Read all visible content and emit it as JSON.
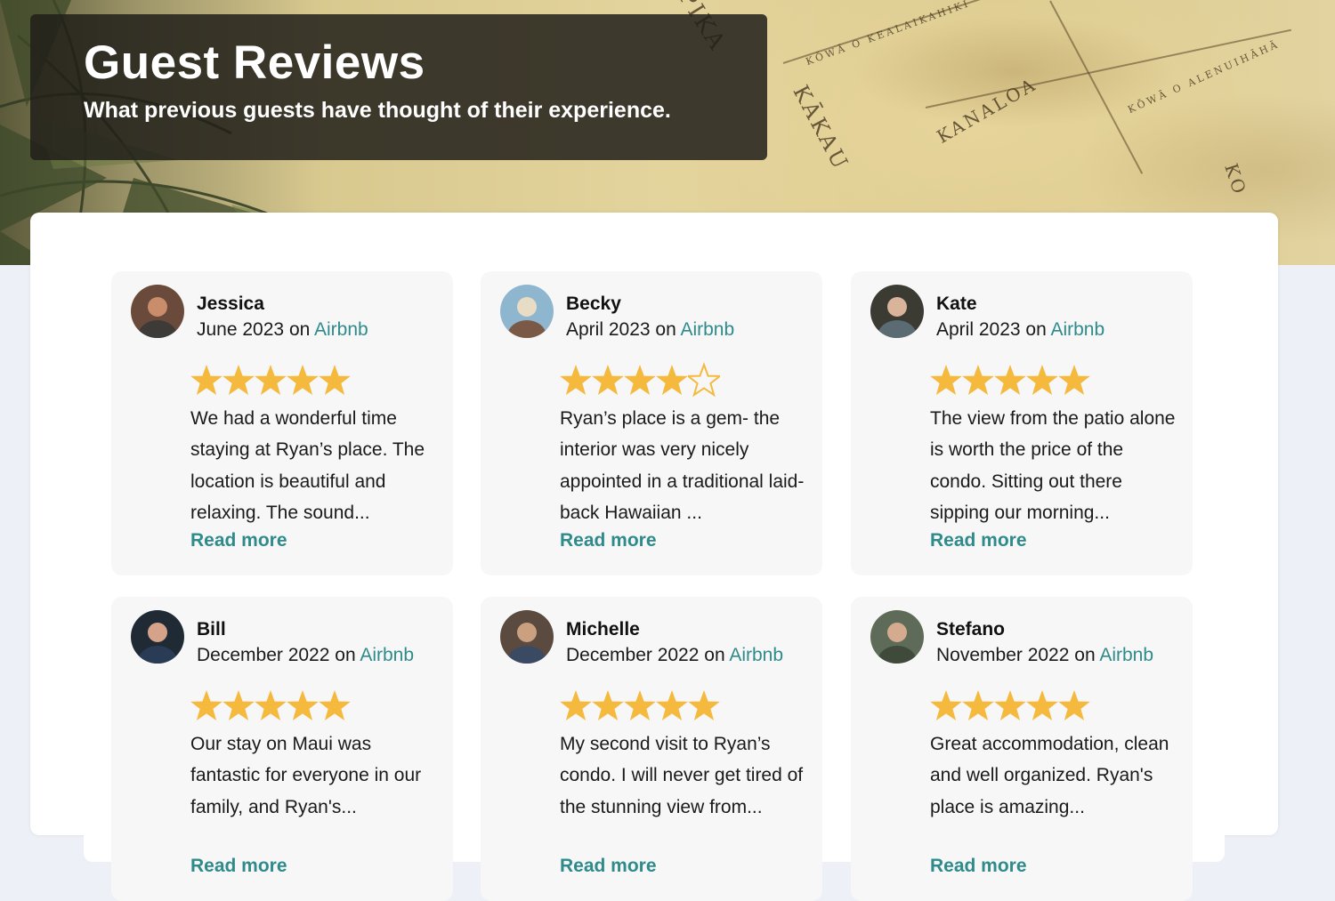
{
  "header": {
    "title": "Guest Reviews",
    "subtitle": "What previous guests have thought of their experience."
  },
  "hero_map_words": [
    "PIKA",
    "KŌWĀ O KEALAIKAHIKI",
    "KANALOA",
    "KĀKAU",
    "KŌWĀ O ALENUIHĀHĀ",
    "KO"
  ],
  "colors": {
    "accent": "#2f8b8b",
    "star": "#f5b93e",
    "panel": "#2a2820",
    "card": "#f7f7f7"
  },
  "reviews": [
    {
      "name": "Jessica",
      "date": "June 2023",
      "on": "on",
      "source": "Airbnb",
      "rating": 5,
      "text": "We had a wonderful time staying at Ryan’s place. The location is beautiful and relaxing. The sound...",
      "read_more": "Read more",
      "avatar_colors": [
        "#6a4a3a",
        "#c98d6b",
        "#3d3a38"
      ]
    },
    {
      "name": "Becky",
      "date": "April 2023",
      "on": "on",
      "source": "Airbnb",
      "rating": 4,
      "text": "Ryan’s place is a gem- the interior was very nicely appointed in a traditional laid-back Hawaiian ...",
      "read_more": "Read more",
      "avatar_colors": [
        "#8fb6cf",
        "#e9dcc4",
        "#7a5a46"
      ]
    },
    {
      "name": "Kate",
      "date": "April 2023",
      "on": "on",
      "source": "Airbnb",
      "rating": 5,
      "text": "The view from the patio alone is worth the price of the condo. Sitting out there sipping our morning...",
      "read_more": "Read more",
      "avatar_colors": [
        "#3b3b33",
        "#d9b49a",
        "#5b6b74"
      ]
    },
    {
      "name": "Bill",
      "date": "December 2022",
      "on": "on",
      "source": "Airbnb",
      "rating": 5,
      "text": "Our stay on Maui was fantastic for everyone in our family, and Ryan's...",
      "read_more": "Read more",
      "avatar_colors": [
        "#1f2a35",
        "#d6a28a",
        "#2a3c55"
      ]
    },
    {
      "name": "Michelle",
      "date": "December 2022",
      "on": "on",
      "source": "Airbnb",
      "rating": 5,
      "text": "My second visit to Ryan’s condo. I will never get tired of the stunning view from...",
      "read_more": "Read more",
      "avatar_colors": [
        "#5a4a40",
        "#caa080",
        "#3a4a62"
      ]
    },
    {
      "name": "Stefano",
      "date": "November 2022",
      "on": "on",
      "source": "Airbnb",
      "rating": 5,
      "text": "Great accommodation, clean and well organized. Ryan's place is amazing...",
      "read_more": "Read more",
      "avatar_colors": [
        "#5e6b58",
        "#d5ab90",
        "#3f4a3a"
      ]
    }
  ]
}
